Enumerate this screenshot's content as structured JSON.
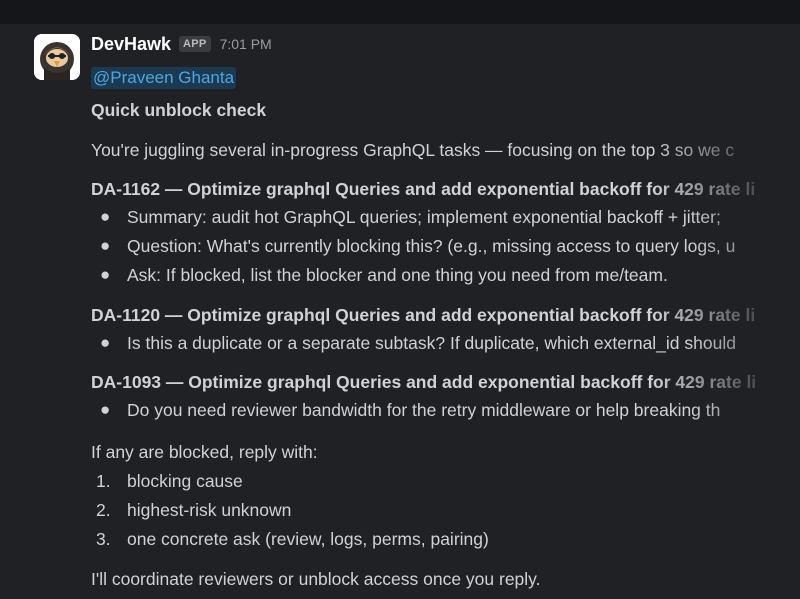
{
  "message": {
    "sender": "DevHawk",
    "badge": "APP",
    "time": "7:01 PM",
    "mention": "@Praveen Ghanta",
    "heading": "Quick unblock check",
    "intro": "You're juggling several in-progress GraphQL tasks — focusing on the top 3 so we c",
    "tasks": [
      {
        "title": "DA-1162 — Optimize graphql Queries and add exponential backoff for 429 rate li",
        "bullets": [
          "Summary: audit hot GraphQL queries; implement exponential backoff + jitter;",
          "Question: What's currently blocking this? (e.g., missing access to query logs, u",
          "Ask: If blocked, list the blocker and one thing you need from me/team."
        ]
      },
      {
        "title": "DA-1120 — Optimize graphql Queries and add exponential backoff for 429 rate li",
        "bullets": [
          "Is this a duplicate or a separate subtask? If duplicate, which external_id should"
        ]
      },
      {
        "title": "DA-1093 — Optimize graphql Queries and add exponential backoff for 429 rate li",
        "bullets": [
          "Do you need reviewer bandwidth for the retry middleware or help breaking th"
        ]
      }
    ],
    "reply_prompt": "If any are blocked, reply with:",
    "reply_items": [
      {
        "num": "1.",
        "text": "blocking cause"
      },
      {
        "num": "2.",
        "text": "highest-risk unknown"
      },
      {
        "num": "3.",
        "text": "one concrete ask (review, logs, perms, pairing)"
      }
    ],
    "closing": "I'll coordinate reviewers or unblock access once you reply."
  },
  "icons": {
    "avatar": "hawk-avatar-icon",
    "bullet": "bullet-dot"
  },
  "colors": {
    "background": "#1f2125",
    "text": "#d1d2d3",
    "mention_bg": "#1b3a52",
    "mention_text": "#4fa6e0"
  }
}
